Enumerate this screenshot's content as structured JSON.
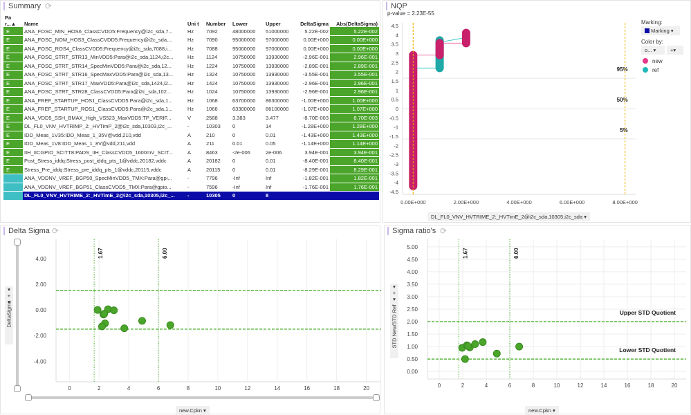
{
  "summary": {
    "title": "Summary",
    "columns": [
      "Pa r...▲",
      "Name",
      "Uni t",
      "Number",
      "Lower",
      "Upper",
      "DeltaSigma",
      "Abs(DeltaSigma)"
    ],
    "rows": [
      [
        "E",
        "ANA_FOSC_MIN_HOS6_ClassCVDD5:Frequency@i2c_sda,7...",
        "Hz",
        "7092",
        "48000000",
        "51000000",
        "5.22E-002",
        "5.22E-002"
      ],
      [
        "E",
        "ANA_FOSC_NOM_HOS3_ClassCVDD5:Frequency@i2c_sda,...",
        "Hz",
        "7090",
        "95000000",
        "97000000",
        "0.00E+000",
        "0.00E+000"
      ],
      [
        "E",
        "ANA_FOSC_ROS4_ClassCVDD5:Frequency@i2c_sda,7088,i...",
        "Hz",
        "7088",
        "95000000",
        "97000000",
        "0.00E+000",
        "0.00E+000"
      ],
      [
        "E",
        "ANA_FOSC_STRT_STR13_MinVDD5:Para@i2c_sda,1124,i2c...",
        "Hz",
        "1124",
        "10750000",
        "13930000",
        "-2.96E-001",
        "2.96E-001"
      ],
      [
        "E",
        "ANA_FOSC_STRT_STR14_SpecMinVDD5:Para@i2c_sda,12...",
        "Hz",
        "1224",
        "10750000",
        "13930000",
        "-2.89E-001",
        "2.89E-001"
      ],
      [
        "E",
        "ANA_FOSC_STRT_STR16_SpecMaxVDD5:Para@i2c_sda,13...",
        "Hz",
        "1324",
        "10750000",
        "13930000",
        "-3.55E-001",
        "3.55E-001"
      ],
      [
        "E",
        "ANA_FOSC_STRT_STR17_MaxVDD5:Para@i2c_sda,1424,i2...",
        "Hz",
        "1424",
        "10750000",
        "13930000",
        "-2.96E-001",
        "2.96E-001"
      ],
      [
        "E",
        "ANA_FOSC_STRT_STR28_ClassCVDD5:Para@i2c_sda,102...",
        "Hz",
        "1024",
        "10750000",
        "13930000",
        "-2.96E-001",
        "2.96E-001"
      ],
      [
        "E",
        "ANA_FREF_STARTUP_HOS1_ClassCVDD5:Para@i2c_sda,1...",
        "Hz",
        "1068",
        "63700000",
        "86300000",
        "-1.00E+000",
        "1.00E+000"
      ],
      [
        "E",
        "ANA_FREF_STARTUP_ROS1_ClassCVDD5:Para@i2c_sda,1...",
        "Hz",
        "1066",
        "63300000",
        "86100000",
        "-1.07E+000",
        "1.07E+000"
      ],
      [
        "E",
        "ANA_VDD5_SSH_BMAX_High_VS523_MaxVDD5:TP_VERIF...",
        "V",
        "2588",
        "3.383",
        "3.477",
        "-8.70E-003",
        "8.70E-003"
      ],
      [
        "E",
        "DL_FL0_VNV_HVTRIMP_2:_HVTimP_2@i2c_sda,10303,i2c_...",
        "-",
        "10303",
        "0",
        "14",
        "-1.28E+000",
        "1.28E+000"
      ],
      [
        "E",
        "IDD_Meas_1V35:IDD_Meas_1_35V@vdd,210,vdd",
        "A",
        "210",
        "0",
        "0.01",
        "-1.43E+000",
        "1.43E+000"
      ],
      [
        "E",
        "IDD_Meas_1V8:IDD_Meas_1_8V@vdd,211,vdd",
        "A",
        "211",
        "0.01",
        "0.05",
        "-1.14E+000",
        "1.14E+000"
      ],
      [
        "E",
        "IIH_IICGPIO_SCITT8:PADS_IIH_ClassCVDD5_1600mV_SCIT...",
        "A",
        "8463",
        "-2e-006",
        "2e-006",
        "3.94E-001",
        "3.94E-001"
      ],
      [
        "E",
        "Post_Stress_iddq:Stress_post_iddq_pts_1@vddc,20182,vddc",
        "A",
        "20182",
        "0",
        "0.01",
        "-8.40E-001",
        "8.40E-001"
      ],
      [
        "E",
        "Stress_Pre_iddq:Stress_pre_iddq_pts_1@vddc,20115,vddc",
        "A",
        "20115",
        "0",
        "0.01",
        "-8.29E-001",
        "8.29E-001"
      ],
      [
        "",
        "ANA_VDDNV_VREF_BGP50_SpecMinVDD5_TMX:Para@gpi...",
        "-",
        "7796",
        "-Inf",
        "Inf",
        "-1.82E-001",
        "1.82E-001"
      ],
      [
        "",
        "ANA_VDDNV_VREF_BGP51_ClassCVDD5_TMX:Para@gpio...",
        "-",
        "7596",
        "-Inf",
        "Inf",
        "-1.76E-001",
        "1.76E-001"
      ],
      [
        "",
        "DL_FL0_VNV_HVTRIME_2:_HVTimE_2@i2c_sda,10305,i2c_...",
        "-",
        "10305",
        "0",
        "8",
        "",
        ""
      ]
    ],
    "colors": {
      "green": "#4aa52a",
      "teal": "#3fbfc4",
      "selected": "#0b0ba8"
    }
  },
  "nqp": {
    "title": "NQP",
    "pvalue": "p-value = 2.23E-55",
    "marking_label": "Marking:",
    "marking_value": "Marking",
    "colorby_label": "Color by:",
    "colorby_value": "o...",
    "plus": "+",
    "x_selector": "DL_FL0_VNV_HVTRIME_2:_HVTimE_2@i2c_sda,10305,i2c_sda"
  },
  "delta": {
    "title": "Delta Sigma",
    "y_selector": "DeltaSigma",
    "x_selector": "new.Cpkn",
    "plus": "+"
  },
  "ratio": {
    "title": "Sigma ratio's",
    "y_selector": "STD New/STD Ref",
    "x_selector": "new.Cpkn",
    "plus": "+"
  },
  "chart_data": [
    {
      "type": "scatter",
      "name": "NQP",
      "xlim": [
        -0.4,
        8.4
      ],
      "ylim": [
        -4.5,
        4.5
      ],
      "xticks": [
        0,
        2,
        4,
        6,
        8
      ],
      "xtick_labels": [
        "0.00E+000",
        "2.00E+000",
        "4.00E+000",
        "6.00E+000",
        "8.00E+000"
      ],
      "yticks": [
        4.5,
        4,
        3.5,
        3,
        2.5,
        2,
        1.5,
        1,
        0.5,
        0,
        -0.5,
        -1,
        -1.5,
        -2,
        -2.5,
        -3,
        -3.5,
        -4,
        -4.5
      ],
      "ytick_labels": [
        "4.5",
        "4",
        "3.5",
        "3",
        "2.5",
        "2",
        "1.5",
        "1",
        "0.5",
        "0",
        "-0.5",
        "-1",
        "-1.5",
        "-2",
        "-2.5",
        "-3",
        "-3.5",
        "-4",
        "-4.5"
      ],
      "vlines": [
        0,
        8
      ],
      "hlines": [
        {
          "y": 1.645,
          "label": "95%"
        },
        {
          "y": 0,
          "label": "50%"
        },
        {
          "y": -1.645,
          "label": "5%"
        }
      ],
      "legend": [
        {
          "name": "new",
          "color": "#e8388a"
        },
        {
          "name": "ref",
          "color": "#1fb8b8"
        }
      ],
      "series": [
        {
          "name": "new",
          "color": "#c8206a",
          "stacks": [
            {
              "x": 0,
              "ymin": -4.2,
              "ymax": 2.9
            },
            {
              "x": 1,
              "ymin": 2.9,
              "ymax": 3.55
            },
            {
              "x": 2,
              "ymin": 3.55,
              "ymax": 4.1
            }
          ]
        },
        {
          "name": "ref",
          "color": "#1fa8a8",
          "stacks": [
            {
              "x": 1,
              "ymin": 2.2,
              "ymax": 3.7
            }
          ]
        }
      ]
    },
    {
      "type": "scatter",
      "name": "Delta Sigma",
      "xlim": [
        -0.9,
        21
      ],
      "ylim": [
        -5.6,
        5.5
      ],
      "xticks": [
        0,
        2,
        4,
        6,
        8,
        10,
        12,
        14,
        16,
        18,
        20
      ],
      "yticks": [
        4,
        2,
        0,
        -2,
        -4
      ],
      "ytick_labels": [
        "4.00",
        "2.00",
        "0.00",
        "-2.00",
        "-4.00"
      ],
      "vlines": [
        {
          "x": 1.67,
          "label": "1.67"
        },
        {
          "x": 6.0,
          "label": "6.00"
        }
      ],
      "hlines": [
        {
          "y": 1.5
        },
        {
          "y": -1.5
        }
      ],
      "points": [
        [
          1.9,
          0
        ],
        [
          2.6,
          0.05
        ],
        [
          3.0,
          -0.03
        ],
        [
          2.3,
          -0.35
        ],
        [
          2.35,
          -0.3
        ],
        [
          2.4,
          -1.05
        ],
        [
          2.2,
          -1.28
        ],
        [
          3.7,
          -1.43
        ],
        [
          4.9,
          -0.85
        ],
        [
          6.8,
          -1.18
        ]
      ],
      "color": "#4aa52a"
    },
    {
      "type": "scatter",
      "name": "Sigma ratio's",
      "xlim": [
        -1,
        21
      ],
      "ylim": [
        -0.3,
        5.3
      ],
      "xticks": [
        0,
        2,
        4,
        6,
        8,
        10,
        12,
        14,
        16,
        18,
        20
      ],
      "yticks": [
        5,
        4.5,
        4,
        3.5,
        3,
        2.5,
        2,
        1.5,
        1,
        0.5,
        0
      ],
      "ytick_labels": [
        "5.00",
        "4.50",
        "4.00",
        "3.50",
        "3.00",
        "2.50",
        "2.00",
        "1.50",
        "1.00",
        "0.50",
        "0.00"
      ],
      "vlines": [
        {
          "x": 1.67,
          "label": "1.67"
        },
        {
          "x": 6.0,
          "label": "6.00"
        }
      ],
      "hlines": [
        {
          "y": 2,
          "label": "Upper STD Quotient"
        },
        {
          "y": 0.5,
          "label": "Lower STD Quotient"
        }
      ],
      "points": [
        [
          1.95,
          0.95
        ],
        [
          2.35,
          1.05
        ],
        [
          2.6,
          0.97
        ],
        [
          2.45,
          1.02
        ],
        [
          3.05,
          1.1
        ],
        [
          3.7,
          1.18
        ],
        [
          2.2,
          0.5
        ],
        [
          4.9,
          0.72
        ],
        [
          6.8,
          1.0
        ]
      ],
      "color": "#4aa52a"
    }
  ]
}
